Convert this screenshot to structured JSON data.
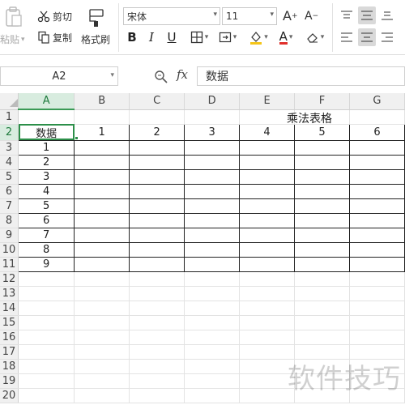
{
  "ribbon": {
    "paste_label": "粘贴",
    "cut_label": "剪切",
    "copy_label": "复制",
    "format_painter_label": "格式刷",
    "font_name": "宋体",
    "font_size": "11",
    "grow_font": "A",
    "shrink_font": "A",
    "bold": "B",
    "italic": "I",
    "underline": "U",
    "font_color_letter": "A"
  },
  "formula_bar": {
    "name_box": "A2",
    "fx_label": "fx",
    "content": "数据"
  },
  "grid": {
    "columns": [
      "A",
      "B",
      "C",
      "D",
      "E",
      "F",
      "G"
    ],
    "rows": [
      "1",
      "2",
      "3",
      "4",
      "5",
      "6",
      "7",
      "8",
      "9",
      "10",
      "11",
      "12",
      "13",
      "14",
      "15",
      "16",
      "17",
      "18",
      "19",
      "20"
    ],
    "title": "乘法表格",
    "header_label": "数据",
    "header_values": [
      "1",
      "2",
      "3",
      "4",
      "5",
      "6"
    ],
    "row_values": [
      "1",
      "2",
      "3",
      "4",
      "5",
      "6",
      "7",
      "8",
      "9"
    ]
  },
  "watermark": "软件技巧",
  "colors": {
    "selection_green": "#2c8f49",
    "header_bg": "#f0f0f0",
    "active_align_bg": "#d9d9d9"
  }
}
